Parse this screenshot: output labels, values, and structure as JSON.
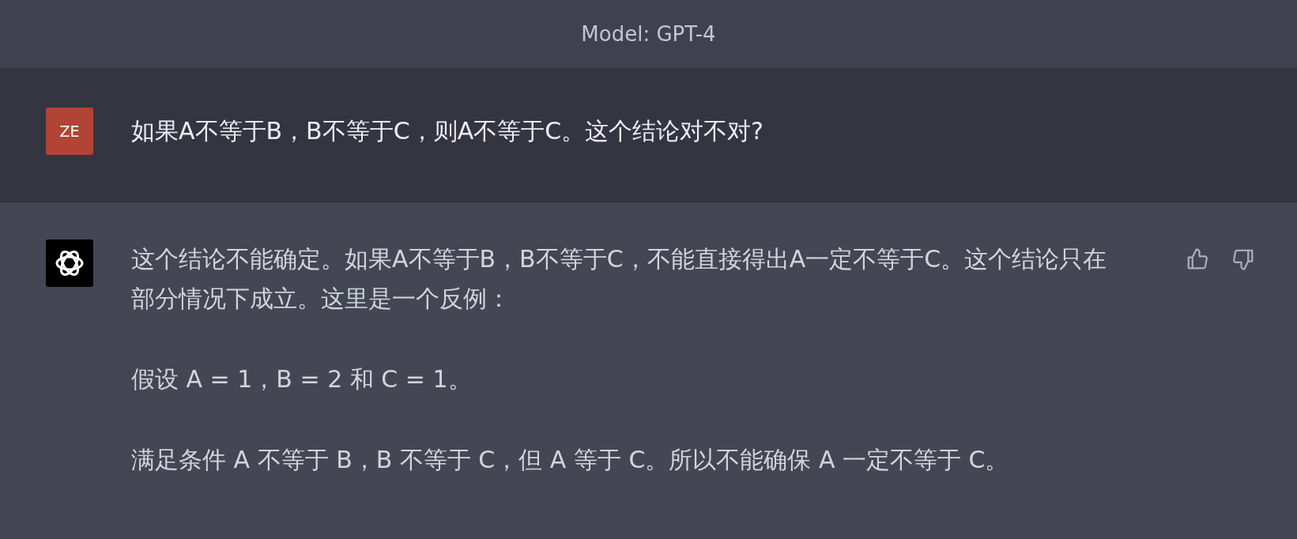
{
  "header": {
    "title": "Model: GPT-4"
  },
  "messages": [
    {
      "kind": "user",
      "avatar": "ZE",
      "paragraphs": [
        "如果A不等于B，B不等于C，则A不等于C。这个结论对不对?"
      ]
    },
    {
      "kind": "assistant",
      "paragraphs": [
        "这个结论不能确定。如果A不等于B，B不等于C，不能直接得出A一定不等于C。这个结论只在部分情况下成立。这里是一个反例：",
        "假设 A = 1，B = 2 和 C = 1。",
        "满足条件 A 不等于 B，B 不等于 C，但 A 等于 C。所以不能确保 A 一定不等于 C。"
      ]
    }
  ]
}
